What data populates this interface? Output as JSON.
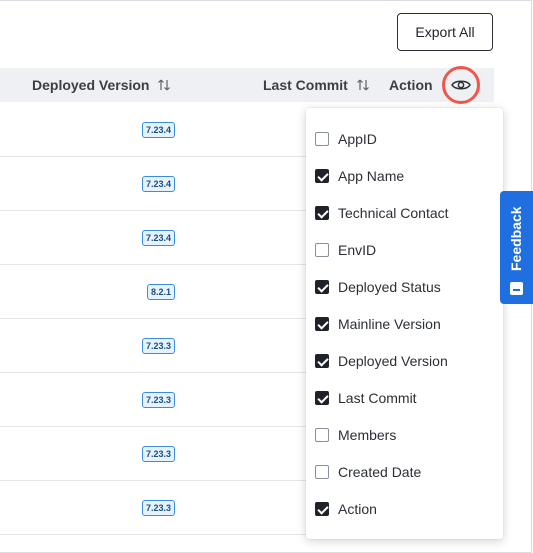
{
  "toolbar": {
    "export_label": "Export All"
  },
  "table": {
    "columns": {
      "deployed_version": "Deployed Version",
      "last_commit": "Last Commit",
      "action": "Action"
    },
    "rows": [
      {
        "deployed_version": "7.23.4"
      },
      {
        "deployed_version": "7.23.4"
      },
      {
        "deployed_version": "7.23.4"
      },
      {
        "deployed_version": "8.2.1"
      },
      {
        "deployed_version": "7.23.3"
      },
      {
        "deployed_version": "7.23.3"
      },
      {
        "deployed_version": "7.23.3"
      },
      {
        "deployed_version": "7.23.3"
      }
    ]
  },
  "column_menu": {
    "options": [
      {
        "label": "AppID",
        "checked": false
      },
      {
        "label": "App Name",
        "checked": true
      },
      {
        "label": "Technical Contact",
        "checked": true
      },
      {
        "label": "EnvID",
        "checked": false
      },
      {
        "label": "Deployed Status",
        "checked": true
      },
      {
        "label": "Mainline Version",
        "checked": true
      },
      {
        "label": "Deployed Version",
        "checked": true
      },
      {
        "label": "Last Commit",
        "checked": true
      },
      {
        "label": "Members",
        "checked": false
      },
      {
        "label": "Created Date",
        "checked": false
      },
      {
        "label": "Action",
        "checked": true
      }
    ]
  },
  "feedback": {
    "label": "Feedback",
    "color": "#1f6fe0"
  },
  "colors": {
    "highlight_ring": "#f0564a",
    "header_bg": "#eef0f3",
    "badge_border": "#3a8dde"
  },
  "icons": {
    "sort": "sort-arrows-icon",
    "eye": "eye-icon"
  }
}
